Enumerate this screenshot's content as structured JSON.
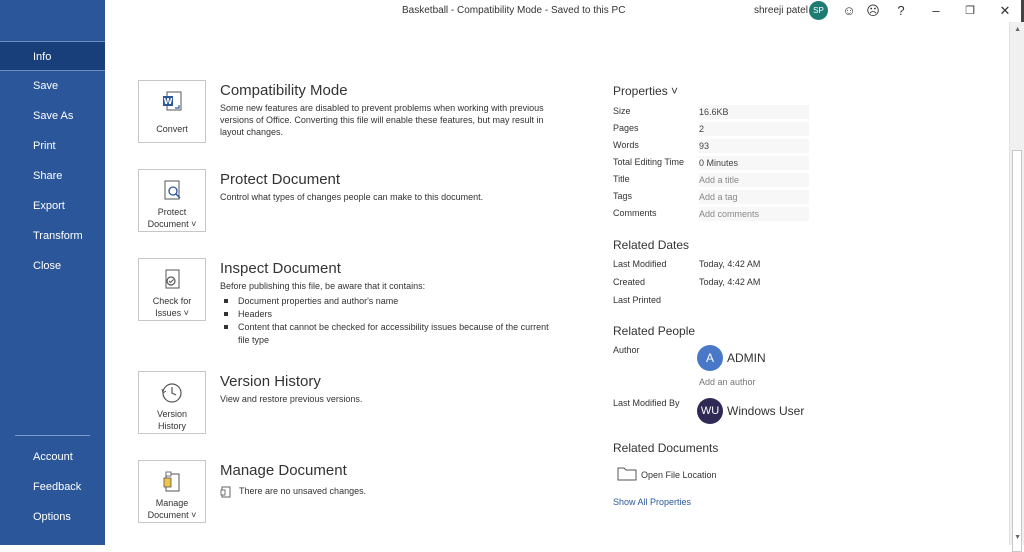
{
  "window": {
    "title": "Basketball  -  Compatibility Mode  -  Saved to this PC",
    "user_name": "shreeji patel",
    "user_initials": "SP",
    "accent": "#2b579a"
  },
  "sidebar": {
    "items": [
      {
        "label": "Info"
      },
      {
        "label": "Save"
      },
      {
        "label": "Save As"
      },
      {
        "label": "Print"
      },
      {
        "label": "Share"
      },
      {
        "label": "Export"
      },
      {
        "label": "Transform"
      },
      {
        "label": "Close"
      }
    ],
    "bottom_items": [
      {
        "label": "Account"
      },
      {
        "label": "Feedback"
      },
      {
        "label": "Options"
      }
    ]
  },
  "sections": {
    "compat": {
      "button": "Convert",
      "title": "Compatibility Mode",
      "desc": "Some new features are disabled to prevent problems when working with previous versions of Office. Converting this file will enable these features, but may result in layout changes."
    },
    "protect": {
      "button_line1": "Protect",
      "button_line2": "Document ˅",
      "title": "Protect Document",
      "desc": "Control what types of changes people can make to this document."
    },
    "inspect": {
      "button_line1": "Check for",
      "button_line2": "Issues ˅",
      "title": "Inspect Document",
      "desc": "Before publishing this file, be aware that it contains:",
      "bullets": [
        "Document properties and author's name",
        "Headers",
        "Content that cannot be checked for accessibility issues because of the current file type"
      ]
    },
    "version": {
      "button_line1": "Version",
      "button_line2": "History",
      "title": "Version History",
      "desc": "View and restore previous versions."
    },
    "manage": {
      "button_line1": "Manage",
      "button_line2": "Document ˅",
      "title": "Manage Document",
      "desc": "There are no unsaved changes."
    }
  },
  "properties": {
    "heading": "Properties ˅",
    "rows": [
      {
        "label": "Size",
        "value": "16.6KB"
      },
      {
        "label": "Pages",
        "value": "2"
      },
      {
        "label": "Words",
        "value": "93"
      },
      {
        "label": "Total Editing Time",
        "value": "0 Minutes"
      },
      {
        "label": "Title",
        "value": "Add a title"
      },
      {
        "label": "Tags",
        "value": "Add a tag"
      },
      {
        "label": "Comments",
        "value": "Add comments"
      }
    ]
  },
  "related_dates": {
    "heading": "Related Dates",
    "rows": [
      {
        "label": "Last Modified",
        "value": "Today, 4:42 AM"
      },
      {
        "label": "Created",
        "value": "Today, 4:42 AM"
      },
      {
        "label": "Last Printed",
        "value": ""
      }
    ]
  },
  "related_people": {
    "heading": "Related People",
    "author_label": "Author",
    "author_initial": "A",
    "author_name": "ADMIN",
    "add_author": "Add an author",
    "modified_label": "Last Modified By",
    "modified_initials": "WU",
    "modified_name": "Windows User"
  },
  "related_documents": {
    "heading": "Related Documents",
    "open_location": "Open File Location",
    "show_all": "Show All Properties"
  }
}
